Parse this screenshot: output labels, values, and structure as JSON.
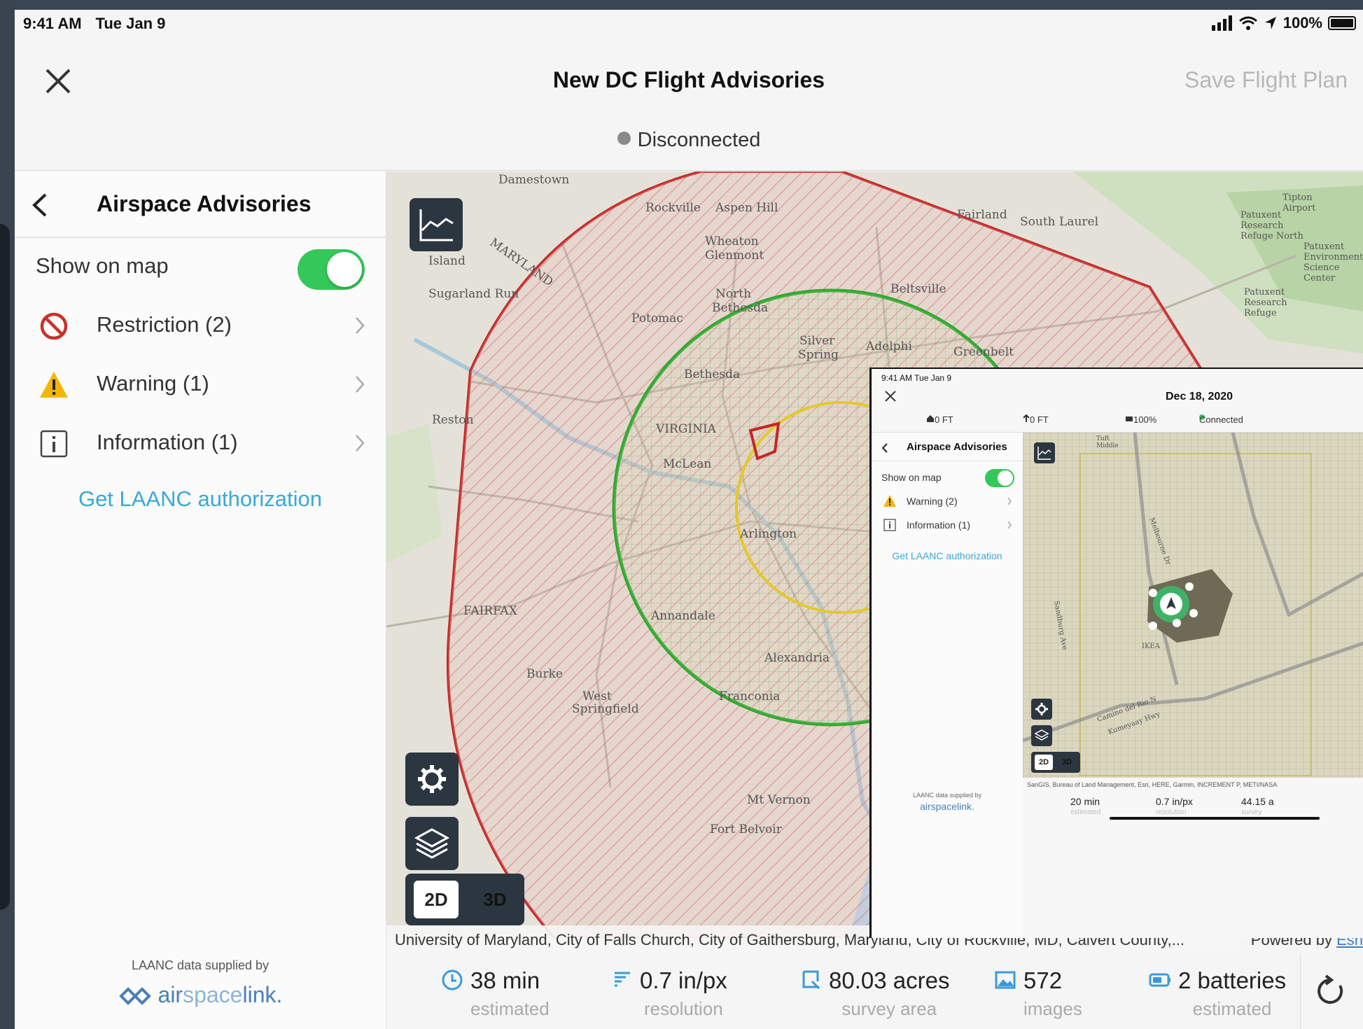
{
  "status_bar": {
    "time": "9:41 AM",
    "date": "Tue Jan 9",
    "battery": "100%"
  },
  "header": {
    "title": "New DC Flight Advisories",
    "save_label": "Save Flight Plan",
    "connection": "Disconnected"
  },
  "sidebar": {
    "title": "Airspace Advisories",
    "show_on_map": "Show on map",
    "items": [
      {
        "label": "Restriction (2)",
        "icon": "restriction-icon"
      },
      {
        "label": "Warning (1)",
        "icon": "warning-icon"
      },
      {
        "label": "Information (1)",
        "icon": "info-icon"
      }
    ],
    "laanc_link": "Get LAANC authorization",
    "supplied_by": "LAANC data supplied by",
    "brand_a": "air",
    "brand_b": "space",
    "brand_c": "link."
  },
  "map": {
    "labels": [
      "Damestown",
      "Rockville",
      "Aspen Hill",
      "Wheaton",
      "Glenmont",
      "Fairland",
      "South Laurel",
      "North",
      "Bethesda",
      "Potomac",
      "Beltsville",
      "Silver",
      "Spring",
      "Adelphi",
      "Greenbelt",
      "Bethesda",
      "Reston",
      "Sugarland Run",
      "Island",
      "MARYLAND",
      "VIRGINIA",
      "McLean",
      "Arlington",
      "Annandale",
      "Alexandria",
      "Burke",
      "West",
      "Springfield",
      "Franconia",
      "Mt Vernon",
      "FAIRFAX",
      "Fort Belvoir",
      "Patuxent Research Refuge North",
      "Patuxent Environmental Science Center",
      "Patuxent Research Refuge",
      "Tipton Airport"
    ],
    "view_2d": "2D",
    "view_3d": "3D",
    "attribution": "University of Maryland, City of Falls Church, City of Gaithersburg, Maryland, City of Rockville, MD, Calvert County,...",
    "powered_by": "Powered by",
    "esri": "Esri"
  },
  "stats": [
    {
      "value": "38 min",
      "unit": "estimated",
      "icon": "clock-icon"
    },
    {
      "value": "0.7 in/px",
      "unit": "resolution",
      "icon": "resolution-icon"
    },
    {
      "value": "80.03 acres",
      "unit": "survey area",
      "icon": "area-icon"
    },
    {
      "value": "572",
      "unit": "images",
      "icon": "image-icon"
    },
    {
      "value": "2 batteries",
      "unit": "estimated",
      "icon": "battery-icon"
    }
  ],
  "inset": {
    "status": "9:41 AM   Tue Jan 9",
    "date": "Dec 18, 2020",
    "home_alt": "0 FT",
    "alt": "0 FT",
    "battery": "100%",
    "connection": "Connected",
    "title": "Airspace Advisories",
    "show_on_map": "Show on map",
    "items": [
      {
        "label": "Warning (2)"
      },
      {
        "label": "Information (1)"
      }
    ],
    "laanc_link": "Get LAANC authorization",
    "supplied_by": "LAANC data supplied by",
    "brand": "airspacelink.",
    "view_2d": "2D",
    "view_3d": "3D",
    "attribution": "SanGIS, Bureau of Land Management, Esri, HERE, Garmin, INCREMENT P, METI/NASA",
    "map_labels": [
      "Tuft Middle",
      "Melbourne Dr",
      "Sandburg Ave",
      "IKEA",
      "Camino del Rio N",
      "Kumeyaay Hwy"
    ],
    "stats": [
      {
        "value": "20 min",
        "unit": "estimated"
      },
      {
        "value": "0.7 in/px",
        "unit": "resolution"
      },
      {
        "value": "44.15 a",
        "unit": "survey"
      }
    ]
  },
  "colors": {
    "restriction": "#c42727",
    "warning_ring": "#2fa82f",
    "inner_ring": "#e5c82a",
    "accent": "#3aa8d8",
    "toggle": "#34c759"
  }
}
